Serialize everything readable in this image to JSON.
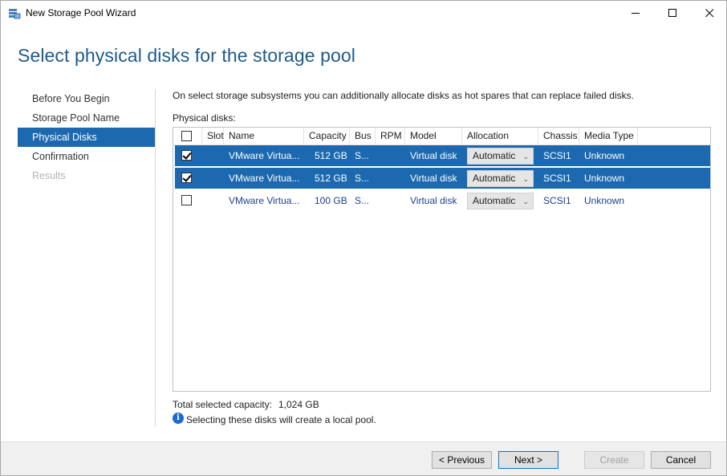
{
  "window": {
    "title": "New Storage Pool Wizard",
    "controls": {
      "minimize": "—",
      "maximize": "☐",
      "close": "✕"
    }
  },
  "page": {
    "heading": "Select physical disks for the storage pool",
    "description": "On select storage subsystems you can additionally allocate disks as hot spares that can replace failed disks.",
    "disks_label": "Physical disks:"
  },
  "nav": {
    "items": [
      {
        "label": "Before You Begin",
        "state": "normal"
      },
      {
        "label": "Storage Pool Name",
        "state": "normal"
      },
      {
        "label": "Physical Disks",
        "state": "active"
      },
      {
        "label": "Confirmation",
        "state": "normal"
      },
      {
        "label": "Results",
        "state": "disabled"
      }
    ]
  },
  "grid": {
    "columns": {
      "slot": "Slot",
      "name": "Name",
      "capacity": "Capacity",
      "bus": "Bus",
      "rpm": "RPM",
      "model": "Model",
      "allocation": "Allocation",
      "chassis": "Chassis",
      "media_type": "Media Type"
    },
    "header_checked": false,
    "rows": [
      {
        "checked": true,
        "selected": true,
        "slot": "",
        "name": "VMware Virtua...",
        "capacity": "512 GB",
        "bus": "S...",
        "rpm": "",
        "model": "Virtual disk",
        "allocation": "Automatic",
        "chassis": "SCSI1",
        "media_type": "Unknown"
      },
      {
        "checked": true,
        "selected": true,
        "slot": "",
        "name": "VMware Virtua...",
        "capacity": "512 GB",
        "bus": "S...",
        "rpm": "",
        "model": "Virtual disk",
        "allocation": "Automatic",
        "chassis": "SCSI1",
        "media_type": "Unknown"
      },
      {
        "checked": false,
        "selected": false,
        "slot": "",
        "name": "VMware Virtua...",
        "capacity": "100 GB",
        "bus": "S...",
        "rpm": "",
        "model": "Virtual disk",
        "allocation": "Automatic",
        "chassis": "SCSI1",
        "media_type": "Unknown"
      }
    ]
  },
  "summary": {
    "total_label": "Total selected capacity:",
    "total_value": "1,024 GB",
    "info_icon": "i",
    "info_text": "Selecting these disks will create a local pool."
  },
  "footer": {
    "previous": "< Previous",
    "next": "Next >",
    "create": "Create",
    "cancel": "Cancel"
  },
  "colors": {
    "accent": "#1c69b0",
    "heading": "#1e5a8a",
    "link_text": "#1e3f8a"
  }
}
